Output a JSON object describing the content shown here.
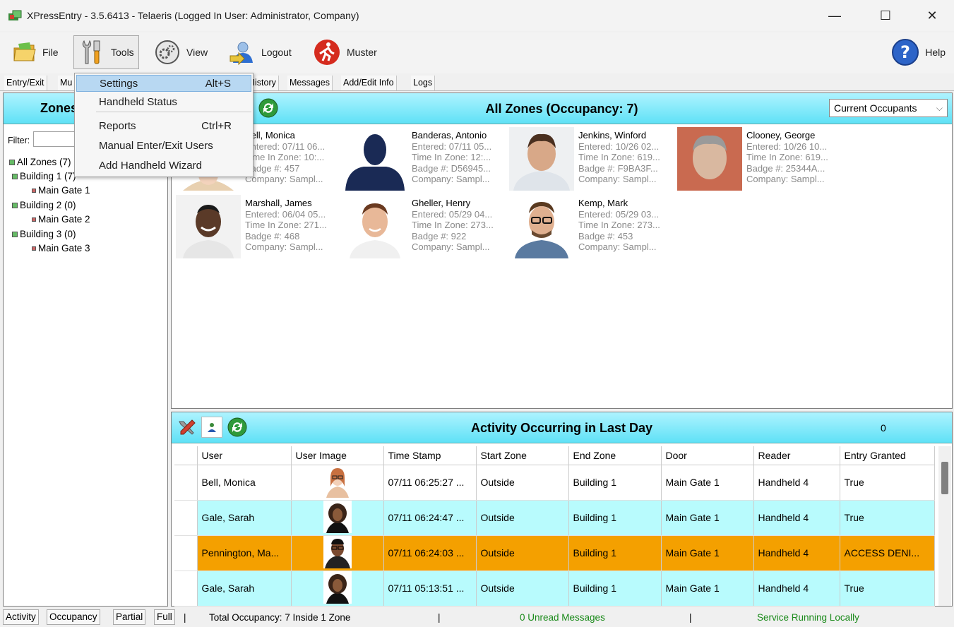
{
  "window": {
    "title": "XPressEntry - 3.5.6413 - Telaeris (Logged In User: Administrator, Company)",
    "minimize": "—",
    "maximize": "☐",
    "close": "✕"
  },
  "menu": {
    "file": "File",
    "tools": "Tools",
    "view": "View",
    "logout": "Logout",
    "muster": "Muster",
    "help": "Help"
  },
  "tabs": [
    "Entry/Exit",
    "Mu",
    "History",
    "Messages",
    "Add/Edit Info",
    "Logs"
  ],
  "tools_menu": {
    "items": [
      {
        "label": "Settings",
        "shortcut": "Alt+S"
      },
      {
        "label": "Handheld Status",
        "shortcut": ""
      },
      {
        "label": "Reports",
        "shortcut": "Ctrl+R"
      },
      {
        "label": "Manual Enter/Exit Users",
        "shortcut": ""
      },
      {
        "label": "Add Handheld Wizard",
        "shortcut": ""
      }
    ]
  },
  "zones": {
    "header": "Zones",
    "filter_label": "Filter:",
    "tree": [
      "All Zones (7)",
      "Building 1 (7)",
      "Main Gate 1",
      "Building 2 (0)",
      "Main Gate 2",
      "Building 3 (0)",
      "Main Gate 3"
    ]
  },
  "occupancy": {
    "title": "All Zones (Occupancy: 7)",
    "view_select": "Current Occupants",
    "cards": [
      {
        "name": "Bell, Monica",
        "entered": "Entered: 07/11 06...",
        "time": "Time In Zone: 10:...",
        "badge": "Badge #: 457",
        "company": "Company: Sampl..."
      },
      {
        "name": "Banderas, Antonio",
        "entered": "Entered: 07/11 05...",
        "time": "Time In Zone: 12:...",
        "badge": "Badge #: D56945...",
        "company": "Company: Sampl..."
      },
      {
        "name": "Jenkins, Winford",
        "entered": "Entered: 10/26 02...",
        "time": "Time In Zone: 619...",
        "badge": "Badge #: F9BA3F...",
        "company": "Company: Sampl..."
      },
      {
        "name": "Clooney, George",
        "entered": "Entered: 10/26 10...",
        "time": "Time In Zone: 619...",
        "badge": "Badge #: 25344A...",
        "company": "Company: Sampl..."
      },
      {
        "name": "Marshall, James",
        "entered": "Entered: 06/04 05...",
        "time": "Time In Zone: 271...",
        "badge": "Badge #: 468",
        "company": "Company: Sampl..."
      },
      {
        "name": "Gheller, Henry",
        "entered": "Entered: 05/29 04...",
        "time": "Time In Zone: 273...",
        "badge": "Badge #: 922",
        "company": "Company: Sampl..."
      },
      {
        "name": "Kemp, Mark",
        "entered": "Entered: 05/29 03...",
        "time": "Time In Zone: 273...",
        "badge": "Badge #: 453",
        "company": "Company: Sampl..."
      }
    ]
  },
  "activity": {
    "title": "Activity Occurring in Last Day",
    "count": "0",
    "columns": [
      "User",
      "User Image",
      "Time Stamp",
      "Start Zone",
      "End Zone",
      "Door",
      "Reader",
      "Entry Granted"
    ],
    "rows": [
      {
        "user": "Bell, Monica",
        "time": "07/11 06:25:27 ...",
        "start": "Outside",
        "end": "Building 1",
        "door": "Main Gate 1",
        "reader": "Handheld 4",
        "granted": "True",
        "style": "white"
      },
      {
        "user": "Gale, Sarah",
        "time": "07/11 06:24:47 ...",
        "start": "Outside",
        "end": "Building 1",
        "door": "Main Gate 1",
        "reader": "Handheld 4",
        "granted": "True",
        "style": "cyan"
      },
      {
        "user": "Pennington, Ma...",
        "time": "07/11 06:24:03 ...",
        "start": "Outside",
        "end": "Building 1",
        "door": "Main Gate 1",
        "reader": "Handheld 4",
        "granted": "ACCESS DENI...",
        "style": "orange"
      },
      {
        "user": "Gale, Sarah",
        "time": "07/11 05:13:51 ...",
        "start": "Outside",
        "end": "Building 1",
        "door": "Main Gate 1",
        "reader": "Handheld 4",
        "granted": "True",
        "style": "cyan"
      }
    ]
  },
  "status": {
    "tabs": [
      "Activity",
      "Occupancy",
      "Partial",
      "Full"
    ],
    "sep": "|",
    "occupancy": "Total Occupancy: 7 Inside 1 Zone",
    "messages": "0 Unread Messages",
    "service": "Service Running Locally",
    "service_color": "#1a8a1a",
    "messages_color": "#1a8a1a"
  }
}
